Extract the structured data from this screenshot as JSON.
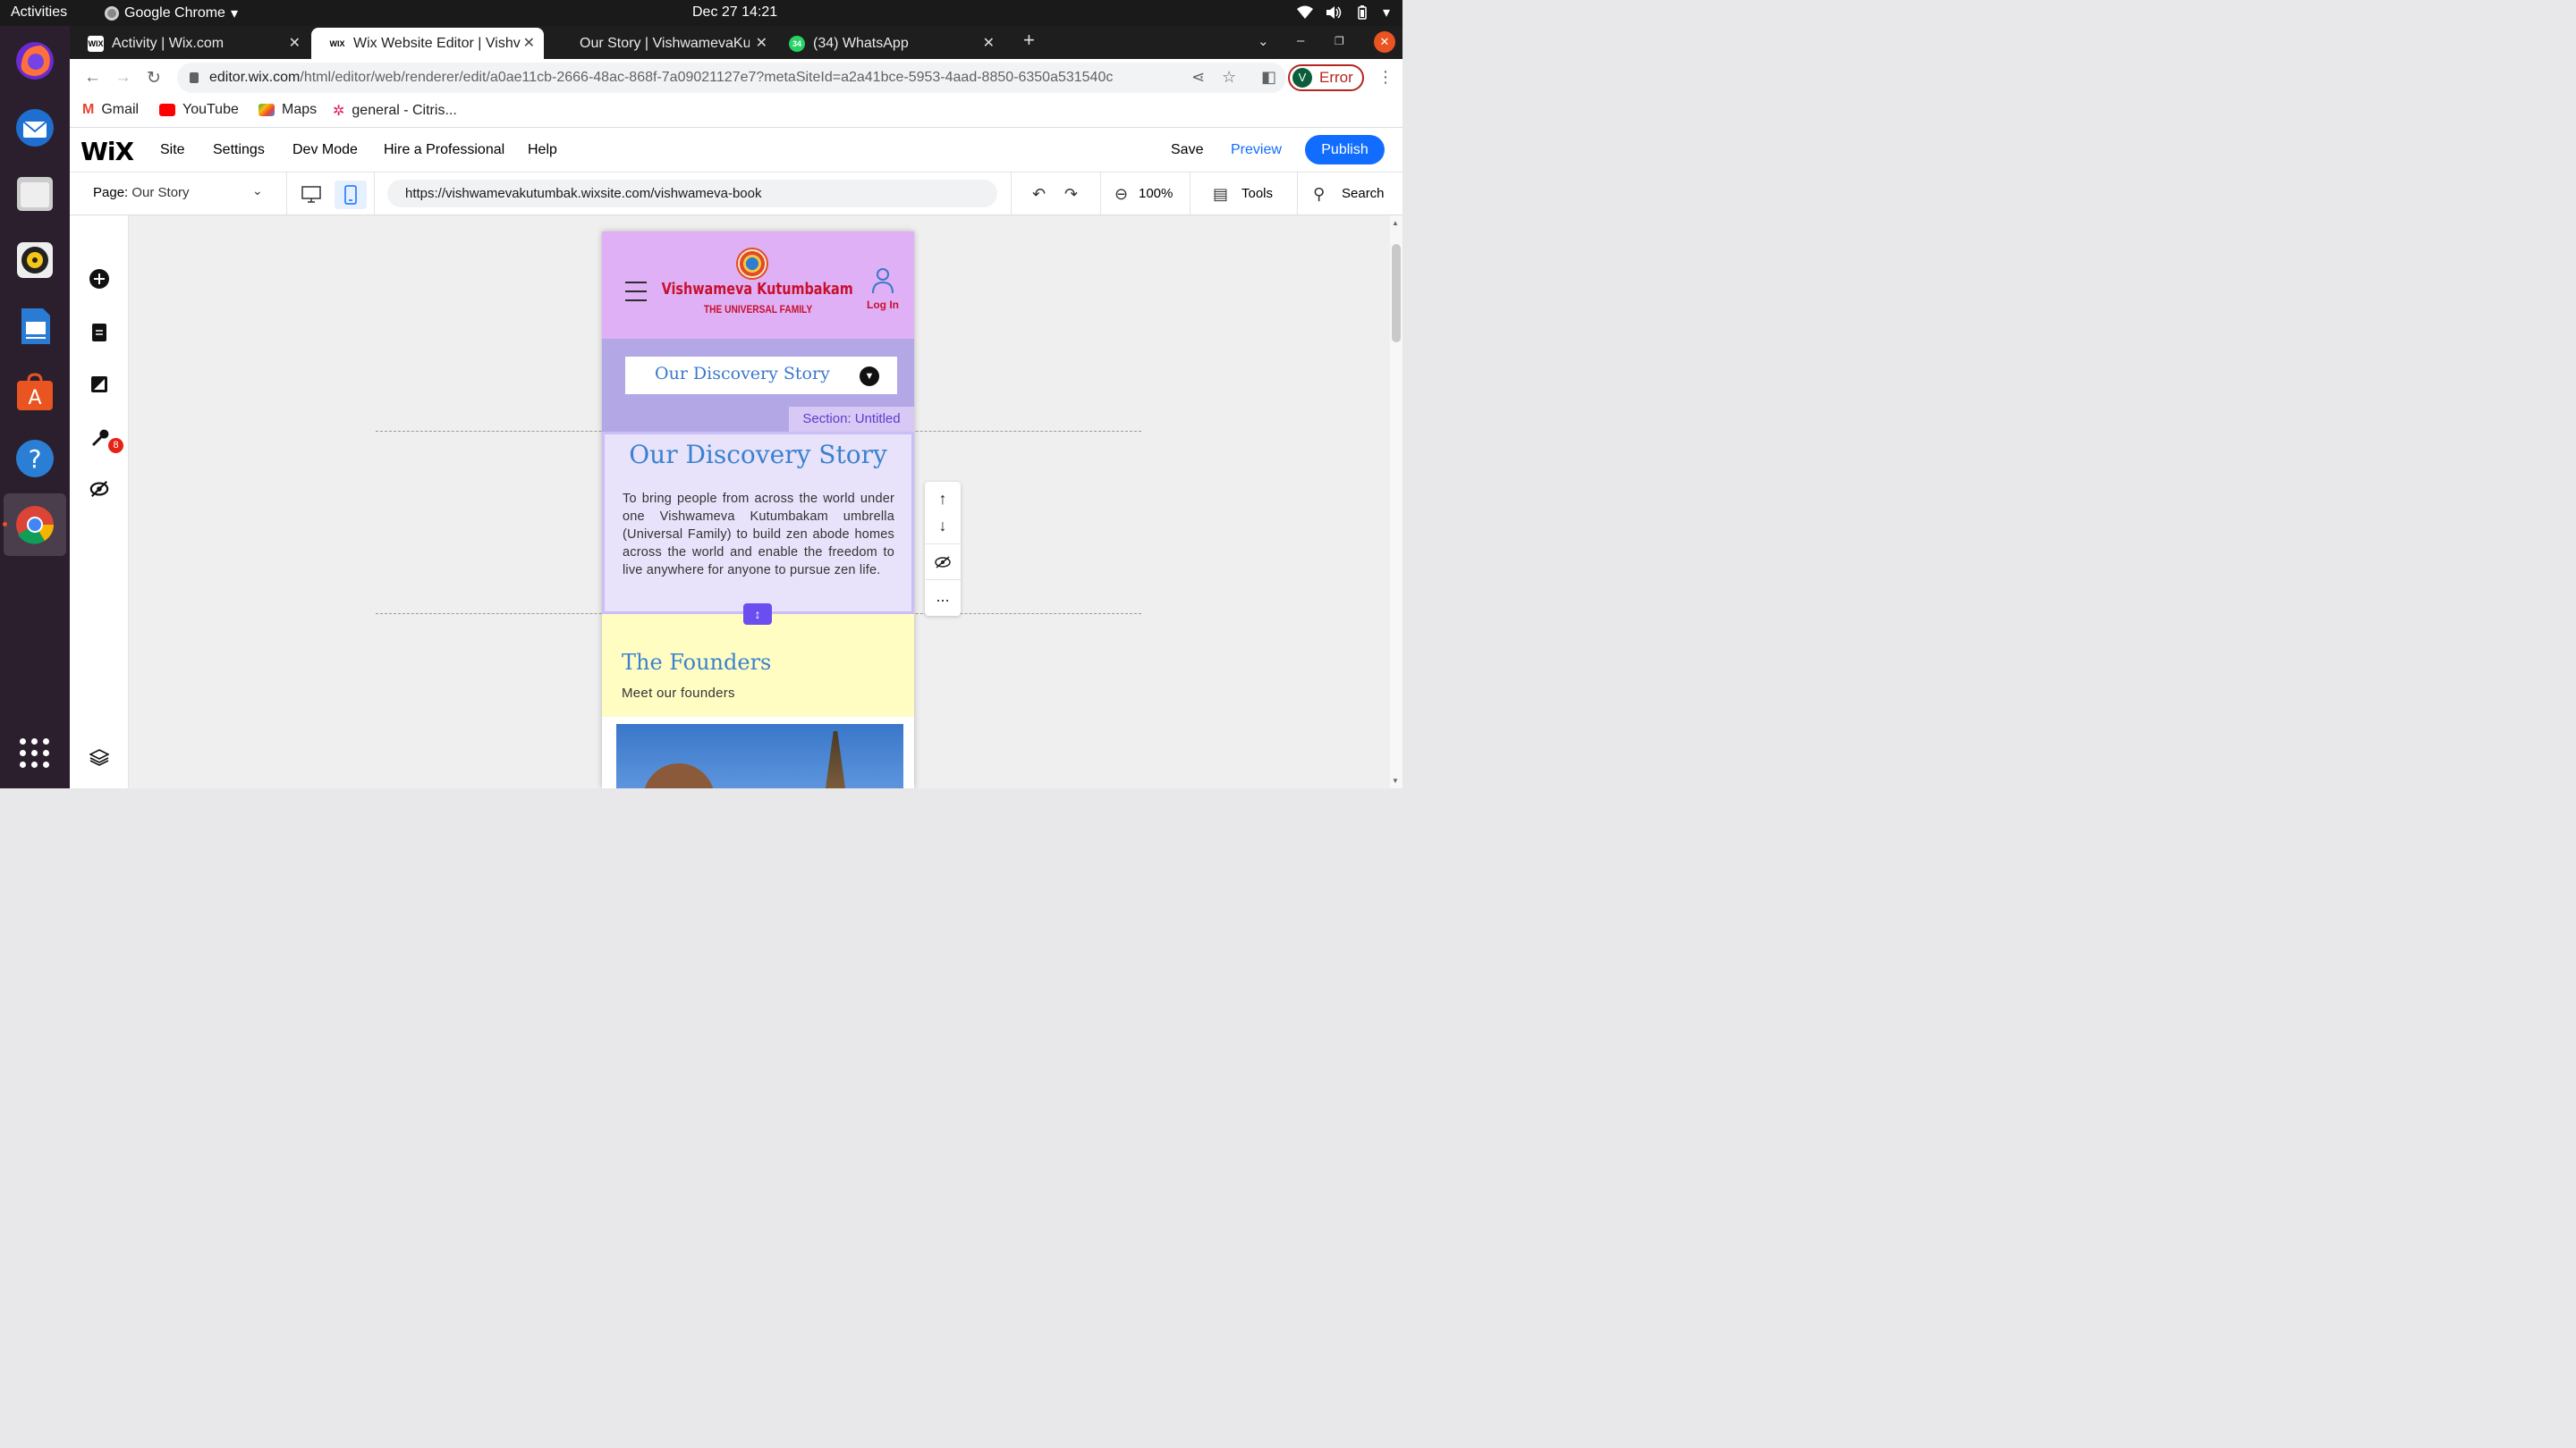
{
  "os": {
    "activities": "Activities",
    "app_name": "Google Chrome",
    "clock": "Dec 27  14:21",
    "dock_badge": "8"
  },
  "tabs": [
    {
      "label": "Activity | Wix.com",
      "favicon": "WIX"
    },
    {
      "label": "Wix Website Editor | Vishv",
      "favicon": "WIX"
    },
    {
      "label": "Our Story | VishwamevaKu",
      "favicon": ""
    },
    {
      "label": "(34) WhatsApp",
      "favicon": "34"
    }
  ],
  "browser": {
    "url_host": "editor.wix.com",
    "url_path": "/html/editor/web/renderer/edit/a0ae11cb-2666-48ac-868f-7a09021127e7?metaSiteId=a2a41bce-5953-4aad-8850-6350a531540c",
    "profile_initial": "V",
    "profile_status": "Error"
  },
  "bookmarks": [
    "Gmail",
    "YouTube",
    "Maps",
    "general - Citris..."
  ],
  "wix": {
    "logo": "WiX",
    "menu": [
      "Site",
      "Settings",
      "Dev Mode",
      "Hire a Professional",
      "Help"
    ],
    "save": "Save",
    "preview": "Preview",
    "publish": "Publish",
    "page_label": "Page:",
    "page_value": "Our Story",
    "site_url": "https://vishwamevakutumbak.wixsite.com/vishwameva-book",
    "zoom": "100%",
    "tools": "Tools",
    "search": "Search"
  },
  "site": {
    "title": "Vishwameva Kutumbakam",
    "subtitle": "THE UNIVERSAL FAMILY",
    "login": "Log In",
    "dropdown": "Our Discovery Story",
    "section_tag": "Section: Untitled",
    "story_heading": "Our Discovery Story",
    "story_body": "To bring people from across the world under one Vishwameva Kutumbakam umbrella (Universal Family) to build zen abode homes across the world and enable the freedom to live anywhere for anyone to pursue zen life.",
    "founders_heading": "The Founders",
    "founders_sub": "Meet our founders"
  },
  "floating_toolbar": {
    "more": "..."
  },
  "colors": {
    "wix_blue": "#116dff",
    "header_pink": "#dfb0f5",
    "band_purple": "#b3a7e6",
    "brand_red": "#c8102e",
    "heading_blue": "#3a82cf",
    "founders_yellow": "#fffdc2"
  }
}
